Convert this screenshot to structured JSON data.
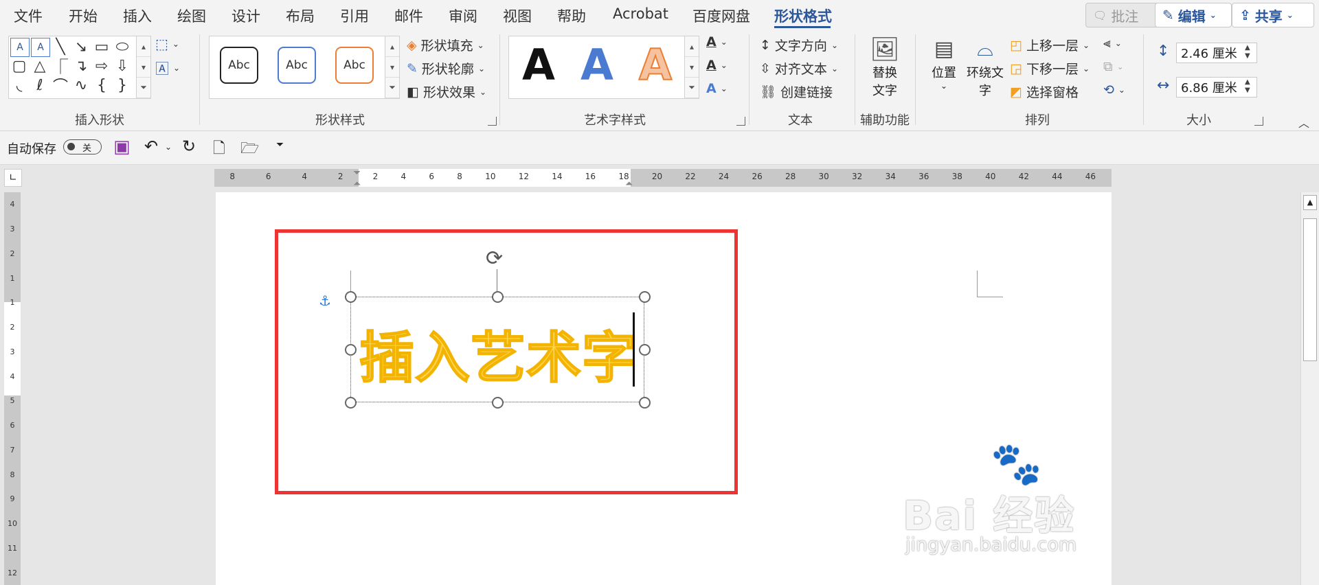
{
  "tabs": [
    "文件",
    "开始",
    "插入",
    "绘图",
    "设计",
    "布局",
    "引用",
    "邮件",
    "审阅",
    "视图",
    "帮助",
    "Acrobat",
    "百度网盘",
    "形状格式"
  ],
  "active_tab": "形状格式",
  "top_buttons": {
    "comments": "批注",
    "editing": "编辑",
    "share": "共享"
  },
  "ribbon": {
    "insert_shapes": {
      "label": "插入形状"
    },
    "shape_styles": {
      "label": "形状样式",
      "presets": [
        "Abc",
        "Abc",
        "Abc"
      ],
      "fill": "形状填充",
      "outline": "形状轮廓",
      "effects": "形状效果"
    },
    "wordart_styles": {
      "label": "艺术字样式",
      "presets": [
        "A",
        "A",
        "A"
      ]
    },
    "text": {
      "label": "文本",
      "direction": "文字方向",
      "align": "对齐文本",
      "link": "创建链接"
    },
    "accessibility": {
      "label": "辅助功能",
      "alt_text_line1": "替换",
      "alt_text_line2": "文字"
    },
    "arrange": {
      "label": "排列",
      "position": "位置",
      "wrap_line1": "环绕文",
      "wrap_line2": "字",
      "bring_forward": "上移一层",
      "send_backward": "下移一层",
      "selection_pane": "选择窗格"
    },
    "size": {
      "label": "大小",
      "height": "2.46 厘米",
      "width": "6.86 厘米"
    }
  },
  "qat": {
    "autosave_label": "自动保存",
    "autosave_state": "关"
  },
  "ruler": {
    "left_ticks": [
      "8",
      "6",
      "4",
      "2"
    ],
    "right_ticks": [
      "2",
      "4",
      "6",
      "8",
      "10",
      "12",
      "14",
      "16",
      "18",
      "20",
      "22",
      "24",
      "26",
      "28",
      "30",
      "32",
      "34",
      "36",
      "38",
      "40",
      "42",
      "44",
      "46"
    ],
    "v_ticks": [
      "4",
      "3",
      "2",
      "1",
      "1",
      "2",
      "3",
      "4",
      "5",
      "6",
      "7",
      "8",
      "9",
      "10",
      "11",
      "12"
    ]
  },
  "document": {
    "wordart_text": "插入艺术字"
  },
  "watermark": {
    "brand": "Bai 经验",
    "url": "jingyan.baidu.com"
  },
  "colors": {
    "accent": "#2b579a",
    "highlight_box": "#ee3333",
    "wordart_fill": "#ffd34d",
    "wordart_outline": "#f2b400"
  }
}
